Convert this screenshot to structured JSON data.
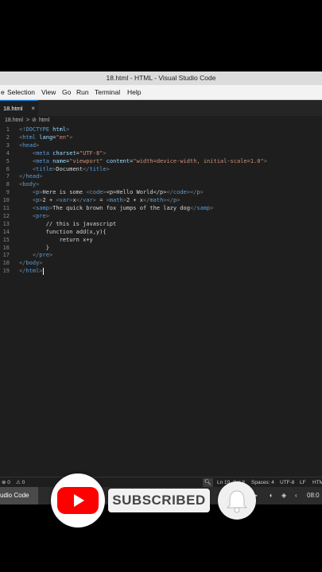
{
  "window": {
    "title": "18.html - HTML - Visual Studio Code"
  },
  "menu": [
    "e",
    "Selection",
    "View",
    "Go",
    "Run",
    "Terminal",
    "Help"
  ],
  "tab": {
    "label": "18.html",
    "close": "×"
  },
  "breadcrumb": {
    "file": "18.html",
    "sep": ">",
    "symbol": "html"
  },
  "code_lines": [
    {
      "n": "1",
      "parts": [
        [
          "br",
          "<!"
        ],
        [
          "tg",
          "DOCTYPE"
        ],
        [
          "tx",
          " "
        ],
        [
          "at",
          "html"
        ],
        [
          "br",
          ">"
        ]
      ]
    },
    {
      "n": "2",
      "parts": [
        [
          "br",
          "<"
        ],
        [
          "tg",
          "html"
        ],
        [
          "tx",
          " "
        ],
        [
          "at",
          "lang"
        ],
        [
          "tx",
          "="
        ],
        [
          "st",
          "\"en\""
        ],
        [
          "br",
          ">"
        ]
      ]
    },
    {
      "n": "3",
      "parts": [
        [
          "br",
          "<"
        ],
        [
          "tg",
          "head"
        ],
        [
          "br",
          ">"
        ]
      ]
    },
    {
      "n": "4",
      "parts": [
        [
          "tx",
          "    "
        ],
        [
          "br",
          "<"
        ],
        [
          "tg",
          "meta"
        ],
        [
          "tx",
          " "
        ],
        [
          "at",
          "charset"
        ],
        [
          "tx",
          "="
        ],
        [
          "st",
          "\"UTF-8\""
        ],
        [
          "br",
          ">"
        ]
      ]
    },
    {
      "n": "5",
      "parts": [
        [
          "tx",
          "    "
        ],
        [
          "br",
          "<"
        ],
        [
          "tg",
          "meta"
        ],
        [
          "tx",
          " "
        ],
        [
          "at",
          "name"
        ],
        [
          "tx",
          "="
        ],
        [
          "st",
          "\"viewport\""
        ],
        [
          "tx",
          " "
        ],
        [
          "at",
          "content"
        ],
        [
          "tx",
          "="
        ],
        [
          "st",
          "\"width=device-width, initial-scale=1.0\""
        ],
        [
          "br",
          ">"
        ]
      ]
    },
    {
      "n": "6",
      "parts": [
        [
          "tx",
          "    "
        ],
        [
          "br",
          "<"
        ],
        [
          "tg",
          "title"
        ],
        [
          "br",
          ">"
        ],
        [
          "tx",
          "Document"
        ],
        [
          "br",
          "</"
        ],
        [
          "tg",
          "title"
        ],
        [
          "br",
          ">"
        ]
      ]
    },
    {
      "n": "7",
      "parts": [
        [
          "br",
          "</"
        ],
        [
          "tg",
          "head"
        ],
        [
          "br",
          ">"
        ]
      ]
    },
    {
      "n": "8",
      "parts": [
        [
          "br",
          "<"
        ],
        [
          "tg",
          "body"
        ],
        [
          "br",
          ">"
        ]
      ]
    },
    {
      "n": "9",
      "parts": [
        [
          "tx",
          "    "
        ],
        [
          "br",
          "<"
        ],
        [
          "tg",
          "p"
        ],
        [
          "br",
          ">"
        ],
        [
          "tx",
          "Here is some "
        ],
        [
          "br",
          "<"
        ],
        [
          "tg",
          "code"
        ],
        [
          "br",
          ">"
        ],
        [
          "tx",
          "<p>Hello World</p>"
        ],
        [
          "br",
          "</"
        ],
        [
          "tg",
          "code"
        ],
        [
          "br",
          ">"
        ],
        [
          "br",
          "</"
        ],
        [
          "tg",
          "p"
        ],
        [
          "br",
          ">"
        ]
      ]
    },
    {
      "n": "10",
      "parts": [
        [
          "tx",
          "    "
        ],
        [
          "br",
          "<"
        ],
        [
          "tg",
          "p"
        ],
        [
          "br",
          ">"
        ],
        [
          "tx",
          "2 + "
        ],
        [
          "br",
          "<"
        ],
        [
          "tg",
          "var"
        ],
        [
          "br",
          ">"
        ],
        [
          "tx",
          "x"
        ],
        [
          "br",
          "</"
        ],
        [
          "tg",
          "var"
        ],
        [
          "br",
          ">"
        ],
        [
          "tx",
          " = "
        ],
        [
          "br",
          "<"
        ],
        [
          "tg",
          "math"
        ],
        [
          "br",
          ">"
        ],
        [
          "tx",
          "2 + x"
        ],
        [
          "br",
          "</"
        ],
        [
          "tg",
          "math"
        ],
        [
          "br",
          ">"
        ],
        [
          "br",
          "</"
        ],
        [
          "tg",
          "p"
        ],
        [
          "br",
          ">"
        ]
      ]
    },
    {
      "n": "11",
      "parts": [
        [
          "tx",
          "    "
        ],
        [
          "br",
          "<"
        ],
        [
          "tg",
          "samp"
        ],
        [
          "br",
          ">"
        ],
        [
          "tx",
          "The quick brown fox jumps of the lazy dog"
        ],
        [
          "br",
          "</"
        ],
        [
          "tg",
          "samp"
        ],
        [
          "br",
          ">"
        ]
      ]
    },
    {
      "n": "12",
      "parts": [
        [
          "tx",
          "    "
        ],
        [
          "br",
          "<"
        ],
        [
          "tg",
          "pre"
        ],
        [
          "br",
          ">"
        ]
      ]
    },
    {
      "n": "13",
      "parts": [
        [
          "tx",
          "        // this is javascript"
        ]
      ]
    },
    {
      "n": "14",
      "parts": [
        [
          "tx",
          "        function add(x,y){"
        ]
      ]
    },
    {
      "n": "15",
      "parts": [
        [
          "tx",
          "            return x+y"
        ]
      ]
    },
    {
      "n": "16",
      "parts": [
        [
          "tx",
          "        }"
        ]
      ]
    },
    {
      "n": "17",
      "parts": [
        [
          "tx",
          "    "
        ],
        [
          "br",
          "</"
        ],
        [
          "tg",
          "pre"
        ],
        [
          "br",
          ">"
        ]
      ]
    },
    {
      "n": "18",
      "parts": [
        [
          "br",
          "</"
        ],
        [
          "tg",
          "body"
        ],
        [
          "br",
          ">"
        ]
      ]
    },
    {
      "n": "19",
      "parts": [
        [
          "br",
          "</"
        ],
        [
          "tg",
          "html"
        ],
        [
          "br",
          ">"
        ]
      ]
    }
  ],
  "status": {
    "errors": "⊗ 0",
    "warnings": "⚠ 0",
    "position": "Ln 19, Col 8",
    "spaces": "Spaces: 4",
    "encoding": "UTF-8",
    "eol": "LF",
    "language": "HTML"
  },
  "taskbar": {
    "app": "udio Code",
    "clock": "08:0"
  },
  "overlay": {
    "subscribe_label": "SUBSCRIBED",
    "brand_red": "#ff0000"
  }
}
